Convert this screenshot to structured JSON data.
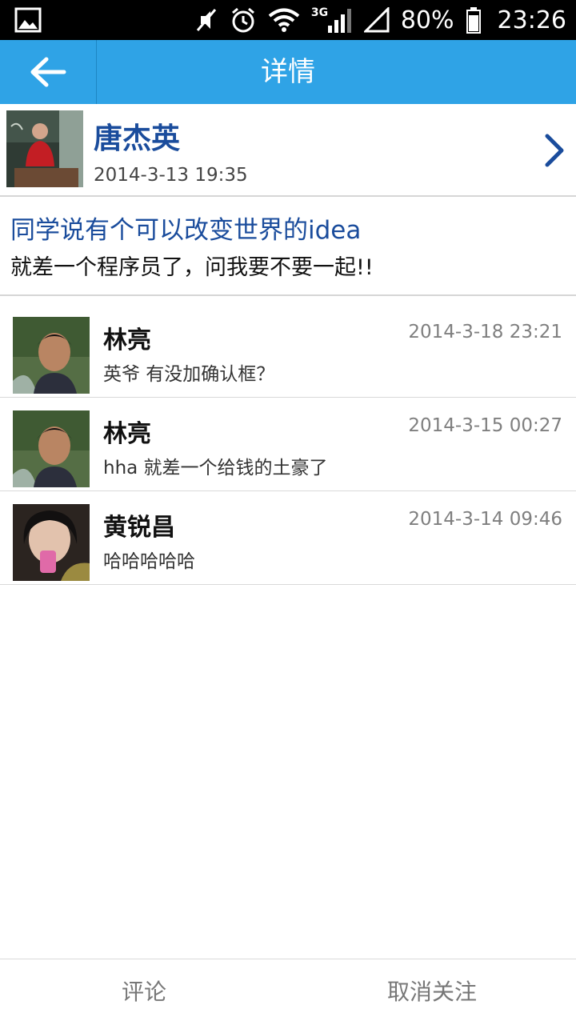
{
  "status_bar": {
    "battery_percent": "80%",
    "time": "23:26",
    "network_type": "3G",
    "icons": [
      "image-icon",
      "mute-icon",
      "alarm-icon",
      "wifi-icon",
      "signal-icon",
      "battery-icon"
    ]
  },
  "header": {
    "title": "详情",
    "back_icon": "back-arrow-icon",
    "background_color": "#2fa3e6"
  },
  "post": {
    "author": "唐杰英",
    "time": "2014-3-13 19:35",
    "title": "同学说有个可以改变世界的idea",
    "content": "就差一个程序员了，问我要不要一起!!",
    "accent_color": "#1a4c9c"
  },
  "comments": [
    {
      "name": "林亮",
      "time": "2014-3-18 23:21",
      "text": "英爷 有没加确认框？"
    },
    {
      "name": "林亮",
      "time": "2014-3-15 00:27",
      "text": "hha 就差一个给钱的土豪了"
    },
    {
      "name": "黄锐昌",
      "time": "2014-3-14 09:46",
      "text": "哈哈哈哈哈"
    }
  ],
  "bottom_bar": {
    "comment_label": "评论",
    "unfollow_label": "取消关注"
  }
}
